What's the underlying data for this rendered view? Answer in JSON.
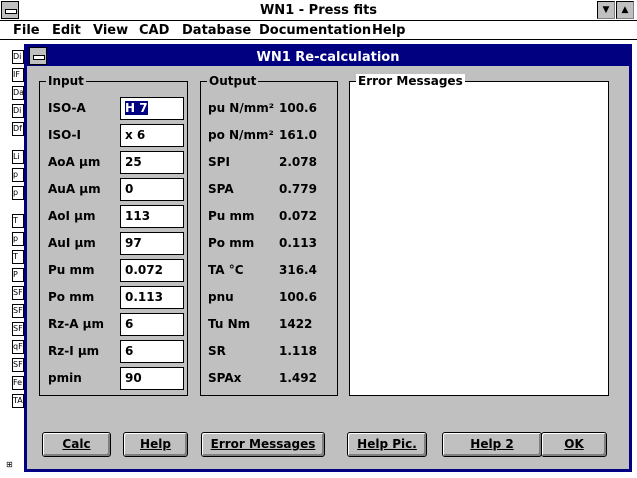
{
  "main_window": {
    "title": "WN1  -  Press fits",
    "menu": [
      "File",
      "Edit",
      "View",
      "CAD",
      "Database",
      "Documentation",
      "Help"
    ],
    "background_labels": [
      "Di",
      "IF",
      "Da",
      "Di",
      "Df",
      "Li",
      "p",
      "p",
      "T",
      "p",
      "T",
      "P",
      "SF",
      "SF",
      "SF",
      "qF",
      "SF",
      "Fe",
      "TA"
    ],
    "bottom_glyph": "⊞"
  },
  "dialog": {
    "title": "WN1    Re-calculation",
    "input": {
      "title": "Input",
      "rows": [
        {
          "label": "ISO-A",
          "value": "H 7"
        },
        {
          "label": "ISO-I",
          "value": "x 6"
        },
        {
          "label": "AoA  µm",
          "value": "25"
        },
        {
          "label": "AuA  µm",
          "value": "0"
        },
        {
          "label": "AoI  µm",
          "value": "113"
        },
        {
          "label": "AuI  µm",
          "value": "97"
        },
        {
          "label": "Pu   mm",
          "value": "0.072"
        },
        {
          "label": "Po   mm",
          "value": "0.113"
        },
        {
          "label": "Rz-A µm",
          "value": "6"
        },
        {
          "label": "Rz-I µm",
          "value": "6"
        },
        {
          "label": "pmin",
          "value": "90"
        }
      ]
    },
    "output": {
      "title": "Output",
      "rows": [
        {
          "label": "pu N/mm²",
          "value": "100.6"
        },
        {
          "label": "po N/mm²",
          "value": "161.0"
        },
        {
          "label": "SPI",
          "value": "2.078"
        },
        {
          "label": "SPA",
          "value": "0.779"
        },
        {
          "label": "Pu   mm",
          "value": "0.072"
        },
        {
          "label": "Po   mm",
          "value": "0.113"
        },
        {
          "label": "TA   °C",
          "value": "316.4"
        },
        {
          "label": "pnu",
          "value": "100.6"
        },
        {
          "label": "Tu   Nm",
          "value": "1422"
        },
        {
          "label": "SR",
          "value": "1.118"
        },
        {
          "label": "SPAx",
          "value": "1.492"
        }
      ]
    },
    "errors": {
      "title": "Error Messages"
    },
    "buttons": [
      "Calc",
      "Help",
      "Error Messages",
      "Help Pic.",
      "Help 2",
      "OK"
    ]
  },
  "colors": {
    "titlebar": "#000080",
    "dialog_bg": "#c0c0c0",
    "window_bg": "#ffffff"
  }
}
